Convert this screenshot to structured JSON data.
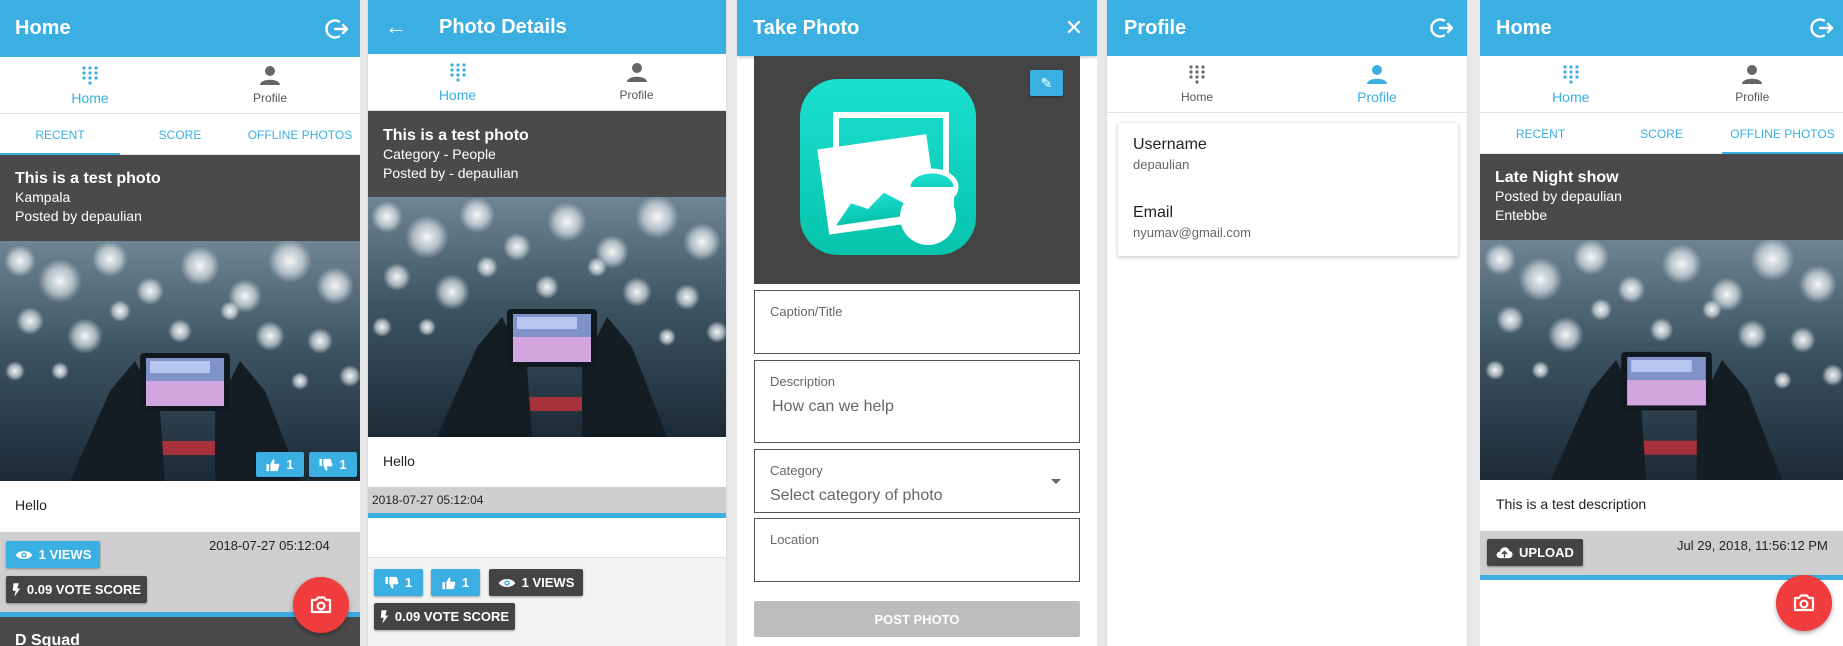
{
  "colors": {
    "primary": "#3baee2",
    "dark_header": "#4a4a4a",
    "fab": "#f03c3c",
    "teal_icon": "#15d9c4"
  },
  "screen1": {
    "title": "Home",
    "nav": [
      {
        "label": "Home",
        "icon": "grid-icon",
        "active": true
      },
      {
        "label": "Profile",
        "icon": "person-icon",
        "active": false
      }
    ],
    "tabs": [
      "RECENT",
      "SCORE",
      "OFFLINE PHOTOS"
    ],
    "active_tab": 0,
    "card": {
      "title": "This is a test photo",
      "location": "Kampala",
      "posted_by": "Posted by depaulian",
      "likes": "1",
      "dislikes": "1",
      "caption": "Hello",
      "views": "1 VIEWS",
      "date": "2018-07-27 05:12:04",
      "vote_score": "0.09 VOTE SCORE"
    },
    "next_card_title": "D Squad"
  },
  "screen2": {
    "title": "Photo Details",
    "nav": [
      {
        "label": "Home",
        "icon": "grid-icon",
        "active": true
      },
      {
        "label": "Profile",
        "icon": "person-icon",
        "active": false
      }
    ],
    "card": {
      "title": "This is a test photo",
      "category": "Category - People",
      "posted_by": "Posted by - depaulian",
      "caption": "Hello",
      "date": "2018-07-27 05:12:04",
      "dislikes": "1",
      "likes": "1",
      "views": "1 VIEWS",
      "vote_score": "0.09 VOTE SCORE"
    }
  },
  "screen3": {
    "title": "Take Photo",
    "form": {
      "caption_label": "Caption/Title",
      "description_label": "Description",
      "description_placeholder": "How can we help",
      "category_label": "Category",
      "category_placeholder": "Select category of photo",
      "location_label": "Location",
      "submit_label": "POST PHOTO"
    }
  },
  "screen4": {
    "title": "Profile",
    "nav": [
      {
        "label": "Home",
        "icon": "grid-icon",
        "active": false
      },
      {
        "label": "Profile",
        "icon": "person-icon",
        "active": true
      }
    ],
    "username_label": "Username",
    "username": "depaulian",
    "email_label": "Email",
    "email": "nyumav@gmail.com"
  },
  "screen5": {
    "title": "Home",
    "nav": [
      {
        "label": "Home",
        "icon": "grid-icon",
        "active": true
      },
      {
        "label": "Profile",
        "icon": "person-icon",
        "active": false
      }
    ],
    "tabs": [
      "RECENT",
      "SCORE",
      "OFFLINE PHOTOS"
    ],
    "active_tab": 2,
    "card": {
      "title": "Late Night show",
      "posted_by": "Posted by depaulian",
      "location": "Entebbe",
      "description": "This is a test description",
      "upload_label": "UPLOAD",
      "date": "Jul 29, 2018, 11:56:12 PM"
    }
  }
}
